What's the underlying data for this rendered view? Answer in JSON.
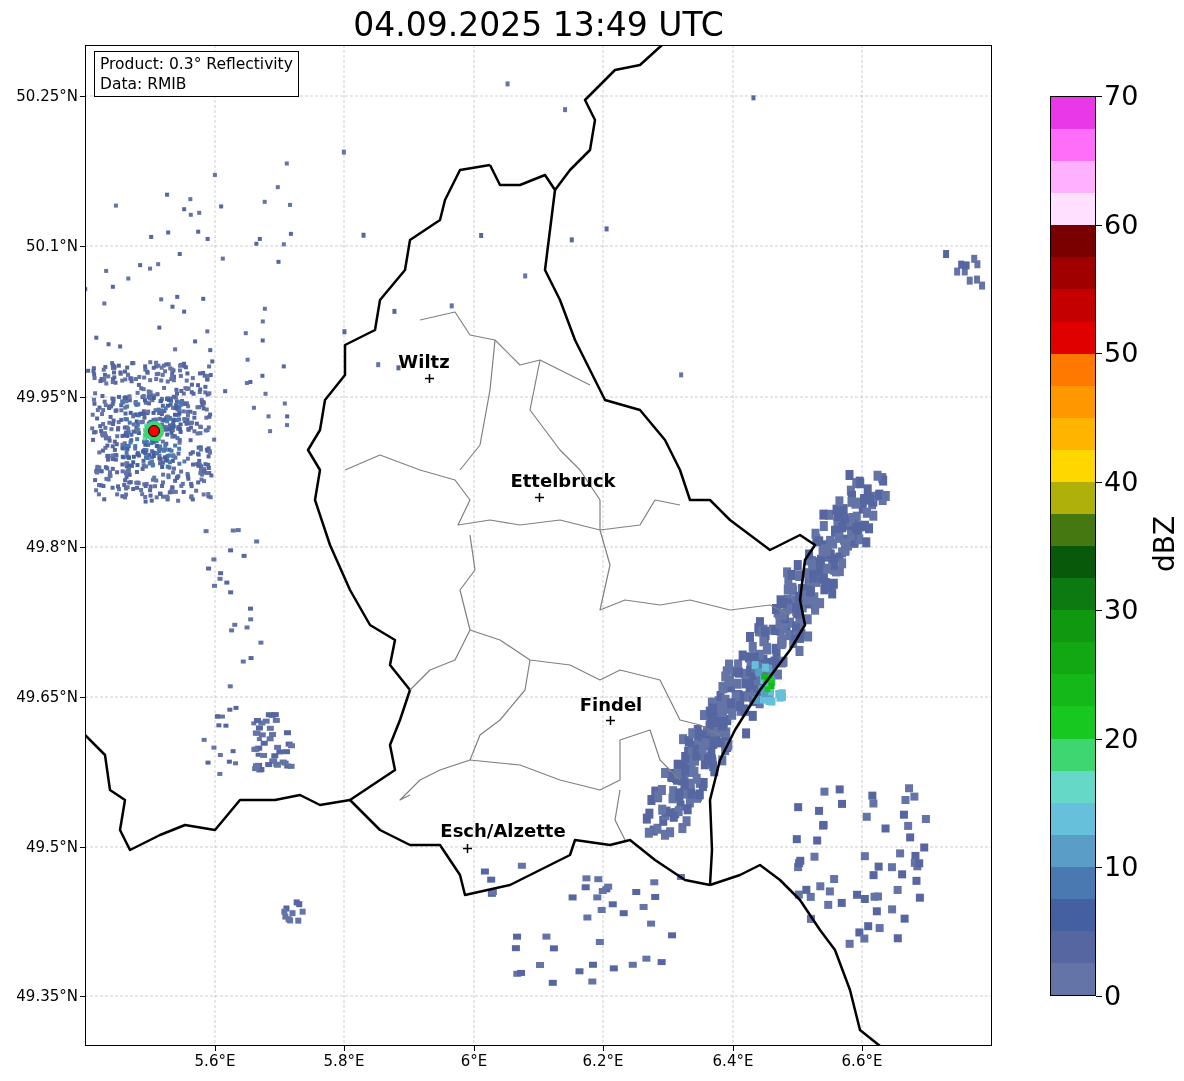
{
  "title": "04.09.2025 13:49 UTC",
  "info_box": {
    "lines": [
      "Product: 0.3° Reflectivity",
      "Data: RMIB"
    ]
  },
  "map": {
    "cities": [
      {
        "name": "Wiltz"
      },
      {
        "name": "Ettelbruck"
      },
      {
        "name": "Findel"
      },
      {
        "name": "Esch/Alzette"
      }
    ],
    "x_ticks": [
      "5.6°E",
      "5.8°E",
      "6°E",
      "6.2°E",
      "6.4°E",
      "6.6°E"
    ],
    "y_ticks": [
      "50.25°N",
      "50.1°N",
      "49.95°N",
      "49.8°N",
      "49.65°N",
      "49.5°N",
      "49.35°N"
    ]
  },
  "colorbar": {
    "label": "dBZ",
    "ticks": [
      "70",
      "60",
      "50",
      "40",
      "30",
      "20",
      "10",
      "0"
    ],
    "bins": [
      {
        "color": "#e838e8"
      },
      {
        "color": "#ff6ef8"
      },
      {
        "color": "#ffb0ff"
      },
      {
        "color": "#ffe0ff"
      },
      {
        "color": "#7a0000"
      },
      {
        "color": "#a00000"
      },
      {
        "color": "#c40000"
      },
      {
        "color": "#e00000"
      },
      {
        "color": "#ff7800"
      },
      {
        "color": "#ff9800"
      },
      {
        "color": "#ffb400"
      },
      {
        "color": "#ffd700"
      },
      {
        "color": "#b0b00a"
      },
      {
        "color": "#467812"
      },
      {
        "color": "#085a0a"
      },
      {
        "color": "#0c7a10"
      },
      {
        "color": "#109810"
      },
      {
        "color": "#12a814"
      },
      {
        "color": "#14b818"
      },
      {
        "color": "#16c820"
      },
      {
        "color": "#3ed670"
      },
      {
        "color": "#66d8c8"
      },
      {
        "color": "#66c0dc"
      },
      {
        "color": "#5a9ec8"
      },
      {
        "color": "#4a78b0"
      },
      {
        "color": "#4560a0"
      },
      {
        "color": "#5566a0"
      },
      {
        "color": "#6474a6"
      }
    ]
  }
}
